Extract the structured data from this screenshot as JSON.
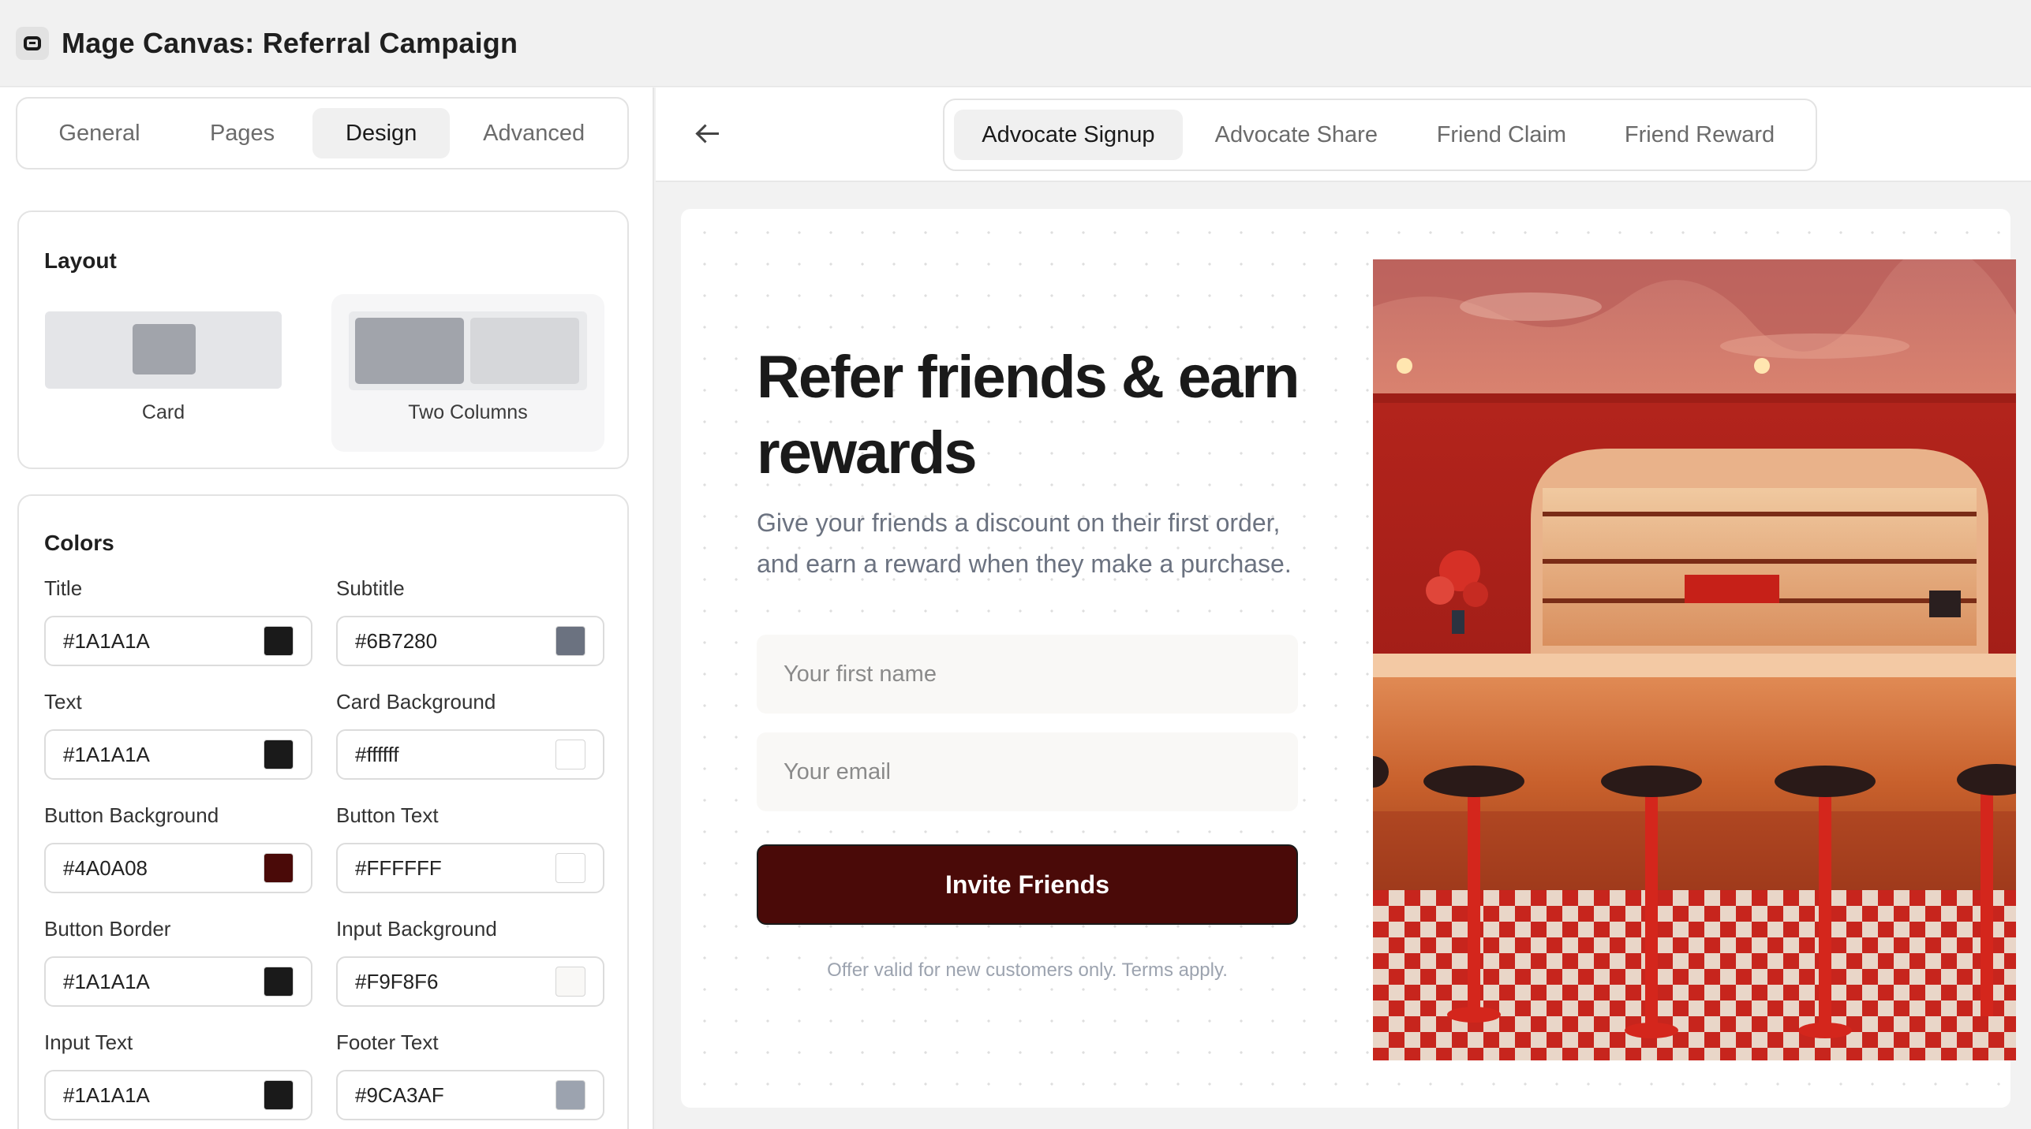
{
  "window": {
    "title": "Mage Canvas: Referral Campaign"
  },
  "settings_tabs": [
    "General",
    "Pages",
    "Design",
    "Advanced"
  ],
  "settings_tabs_active": "Design",
  "layout": {
    "title": "Layout",
    "options": [
      {
        "label": "Card",
        "selected": false
      },
      {
        "label": "Two Columns",
        "selected": true
      }
    ]
  },
  "colors": {
    "title": "Colors",
    "fields": [
      {
        "label": "Title",
        "value": "#1A1A1A",
        "swatch": "#1A1A1A"
      },
      {
        "label": "Subtitle",
        "value": "#6B7280",
        "swatch": "#6B7280"
      },
      {
        "label": "Text",
        "value": "#1A1A1A",
        "swatch": "#1A1A1A"
      },
      {
        "label": "Card Background",
        "value": "#ffffff",
        "swatch": "#ffffff"
      },
      {
        "label": "Button Background",
        "value": "#4A0A08",
        "swatch": "#4A0A08"
      },
      {
        "label": "Button Text",
        "value": "#FFFFFF",
        "swatch": "#FFFFFF"
      },
      {
        "label": "Button Border",
        "value": "#1A1A1A",
        "swatch": "#1A1A1A"
      },
      {
        "label": "Input Background",
        "value": "#F9F8F6",
        "swatch": "#F9F8F6"
      },
      {
        "label": "Input Text",
        "value": "#1A1A1A",
        "swatch": "#1A1A1A"
      },
      {
        "label": "Footer Text",
        "value": "#9CA3AF",
        "swatch": "#9CA3AF"
      }
    ]
  },
  "page_tabs": [
    "Advocate Signup",
    "Advocate Share",
    "Friend Claim",
    "Friend Reward"
  ],
  "page_tabs_active": "Advocate Signup",
  "preview": {
    "headline": "Refer friends & earn rewards",
    "subtitle": "Give your friends a discount on their first order, and earn a reward when they make a purchase.",
    "name_placeholder": "Your first name",
    "email_placeholder": "Your email",
    "cta_label": "Invite Friends",
    "footer": "Offer valid for new customers only. Terms apply."
  },
  "icons": {
    "app": "mage-logo-icon",
    "back": "arrow-left-icon"
  }
}
